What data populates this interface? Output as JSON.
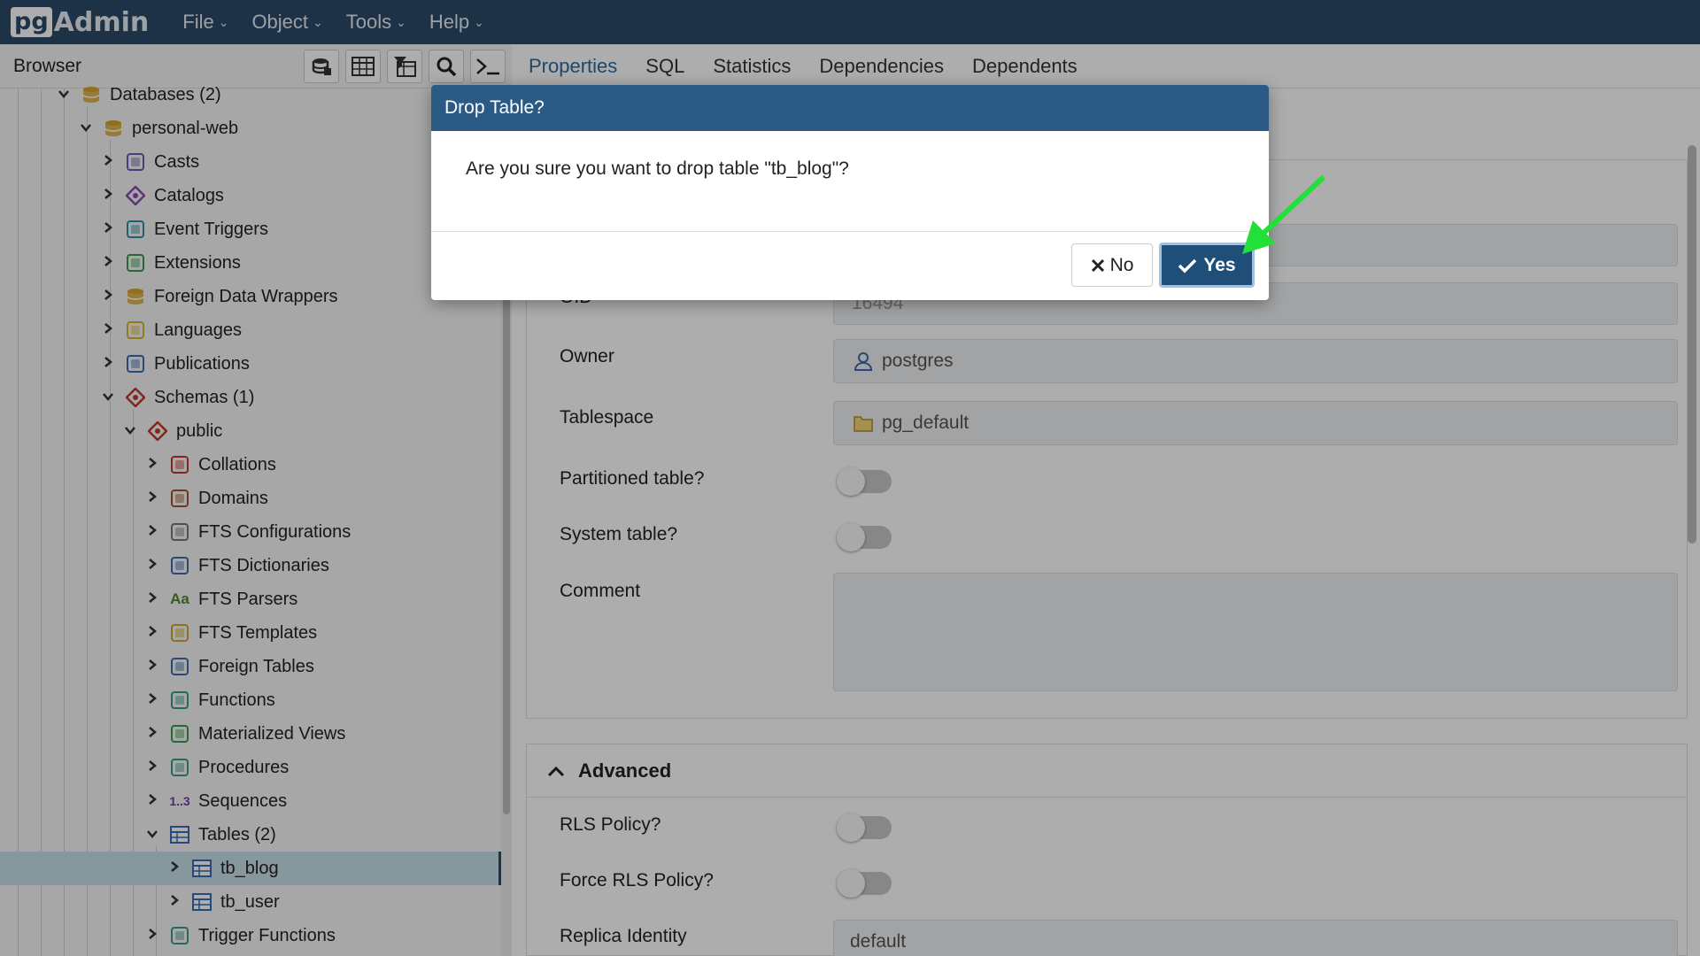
{
  "app": {
    "logo_pg": "pg",
    "logo_admin": "Admin"
  },
  "menu": [
    {
      "label": "File"
    },
    {
      "label": "Object"
    },
    {
      "label": "Tools"
    },
    {
      "label": "Help"
    }
  ],
  "browser": {
    "title": "Browser",
    "tools": [
      "database-icon",
      "table-icon",
      "filtered-rows-icon",
      "search-icon",
      "terminal-icon"
    ],
    "tree": [
      {
        "label": "Databases (2)",
        "expanded": true,
        "icon": "databases-icon",
        "color": "#d6a52a"
      },
      {
        "label": "personal-web",
        "expanded": true,
        "icon": "database-icon",
        "color": "#d6a52a"
      },
      {
        "label": "Casts",
        "expanded": false,
        "icon": "casts-icon",
        "color": "#6b5bb5"
      },
      {
        "label": "Catalogs",
        "expanded": false,
        "icon": "catalogs-icon",
        "color": "#8a4bb5"
      },
      {
        "label": "Event Triggers",
        "expanded": false,
        "icon": "event-triggers-icon",
        "color": "#2a8fa5"
      },
      {
        "label": "Extensions",
        "expanded": false,
        "icon": "extensions-icon",
        "color": "#3a9a4b"
      },
      {
        "label": "Foreign Data Wrappers",
        "expanded": false,
        "icon": "foreign-data-wrappers-icon",
        "color": "#d6a52a"
      },
      {
        "label": "Languages",
        "expanded": false,
        "icon": "languages-icon",
        "color": "#d6b52a"
      },
      {
        "label": "Publications",
        "expanded": false,
        "icon": "publications-icon",
        "color": "#3a6ab5"
      },
      {
        "label": "Schemas (1)",
        "expanded": true,
        "icon": "schemas-icon",
        "color": "#c0392b"
      },
      {
        "label": "public",
        "expanded": true,
        "icon": "schema-icon",
        "color": "#c0392b"
      },
      {
        "label": "Collations",
        "expanded": false,
        "icon": "collations-icon",
        "color": "#c0392b"
      },
      {
        "label": "Domains",
        "expanded": false,
        "icon": "domains-icon",
        "color": "#a0522d"
      },
      {
        "label": "FTS Configurations",
        "expanded": false,
        "icon": "fts-configurations-icon",
        "color": "#777777"
      },
      {
        "label": "FTS Dictionaries",
        "expanded": false,
        "icon": "fts-dictionaries-icon",
        "color": "#3a6ab5"
      },
      {
        "label": "FTS Parsers",
        "expanded": false,
        "icon": "fts-parsers-icon",
        "color": "#4b8a2a"
      },
      {
        "label": "FTS Templates",
        "expanded": false,
        "icon": "fts-templates-icon",
        "color": "#d6a52a"
      },
      {
        "label": "Foreign Tables",
        "expanded": false,
        "icon": "foreign-tables-icon",
        "color": "#3a6ab5"
      },
      {
        "label": "Functions",
        "expanded": false,
        "icon": "functions-icon",
        "color": "#3a9a8a"
      },
      {
        "label": "Materialized Views",
        "expanded": false,
        "icon": "materialized-views-icon",
        "color": "#3a9a4b"
      },
      {
        "label": "Procedures",
        "expanded": false,
        "icon": "procedures-icon",
        "color": "#3a9a8a"
      },
      {
        "label": "Sequences",
        "expanded": false,
        "icon": "sequences-icon",
        "color": "#6b3ab5"
      },
      {
        "label": "Tables (2)",
        "expanded": true,
        "icon": "tables-icon",
        "color": "#3a6ab5"
      },
      {
        "label": "tb_blog",
        "expanded": false,
        "icon": "table-icon",
        "color": "#3a6ab5"
      },
      {
        "label": "tb_user",
        "expanded": false,
        "icon": "table-icon",
        "color": "#3a6ab5"
      },
      {
        "label": "Trigger Functions",
        "expanded": false,
        "icon": "trigger-functions-icon",
        "color": "#3a9a8a"
      }
    ],
    "sequences_glyph": "1..3",
    "fts_parsers_glyph": "Aa"
  },
  "tabs": [
    {
      "label": "Properties",
      "active": true
    },
    {
      "label": "SQL",
      "active": false
    },
    {
      "label": "Statistics",
      "active": false
    },
    {
      "label": "Dependencies",
      "active": false
    },
    {
      "label": "Dependents",
      "active": false
    }
  ],
  "properties": {
    "oid_label": "OID",
    "oid_value": "16494",
    "owner_label": "Owner",
    "owner_value": "postgres",
    "tablespace_label": "Tablespace",
    "tablespace_value": "pg_default",
    "partitioned_label": "Partitioned table?",
    "system_label": "System table?",
    "comment_label": "Comment",
    "advanced_title": "Advanced",
    "rls_label": "RLS Policy?",
    "force_rls_label": "Force RLS Policy?",
    "replica_label": "Replica Identity",
    "replica_value": "default"
  },
  "dialog": {
    "title": "Drop Table?",
    "message": "Are you sure you want to drop table \"tb_blog\"?",
    "no_label": "No",
    "yes_label": "Yes"
  },
  "colors": {
    "navbar": "#2b4a68",
    "dialog_header": "#2b5a85",
    "yes_button": "#1f4e79",
    "selected_row": "#c7dfe9",
    "arrow": "#22e03a"
  }
}
